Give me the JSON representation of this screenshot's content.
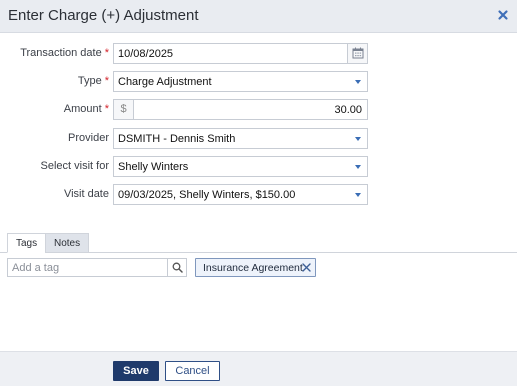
{
  "dialog": {
    "title": "Enter Charge (+) Adjustment",
    "close_icon": "close-icon"
  },
  "form": {
    "required_mark": "*",
    "transaction_date": {
      "label": "Transaction date",
      "value": "10/08/2025",
      "required": true,
      "icon": "calendar-icon"
    },
    "type": {
      "label": "Type",
      "value": "Charge Adjustment",
      "required": true
    },
    "amount": {
      "label": "Amount",
      "currency": "$",
      "value": "30.00",
      "required": true
    },
    "provider": {
      "label": "Provider",
      "value": "DSMITH - Dennis Smith"
    },
    "select_visit_for": {
      "label": "Select visit for",
      "value": "Shelly Winters"
    },
    "visit_date": {
      "label": "Visit date",
      "value": "09/03/2025, Shelly Winters, $150.00"
    }
  },
  "tabs": [
    {
      "label": "Tags",
      "active": true
    },
    {
      "label": "Notes",
      "active": false
    }
  ],
  "tags": {
    "placeholder": "Add a tag",
    "search_icon": "search-icon",
    "chips": [
      {
        "label": "Insurance Agreement"
      }
    ]
  },
  "footer": {
    "save_label": "Save",
    "cancel_label": "Cancel"
  },
  "colors": {
    "header_bg": "#e9ecf1",
    "required": "#d3222a",
    "dropdown_caret": "#3a6db5",
    "save_bg": "#1f3a6b",
    "cancel_border": "#2f4f86",
    "chip_bg": "#eef3fb"
  }
}
